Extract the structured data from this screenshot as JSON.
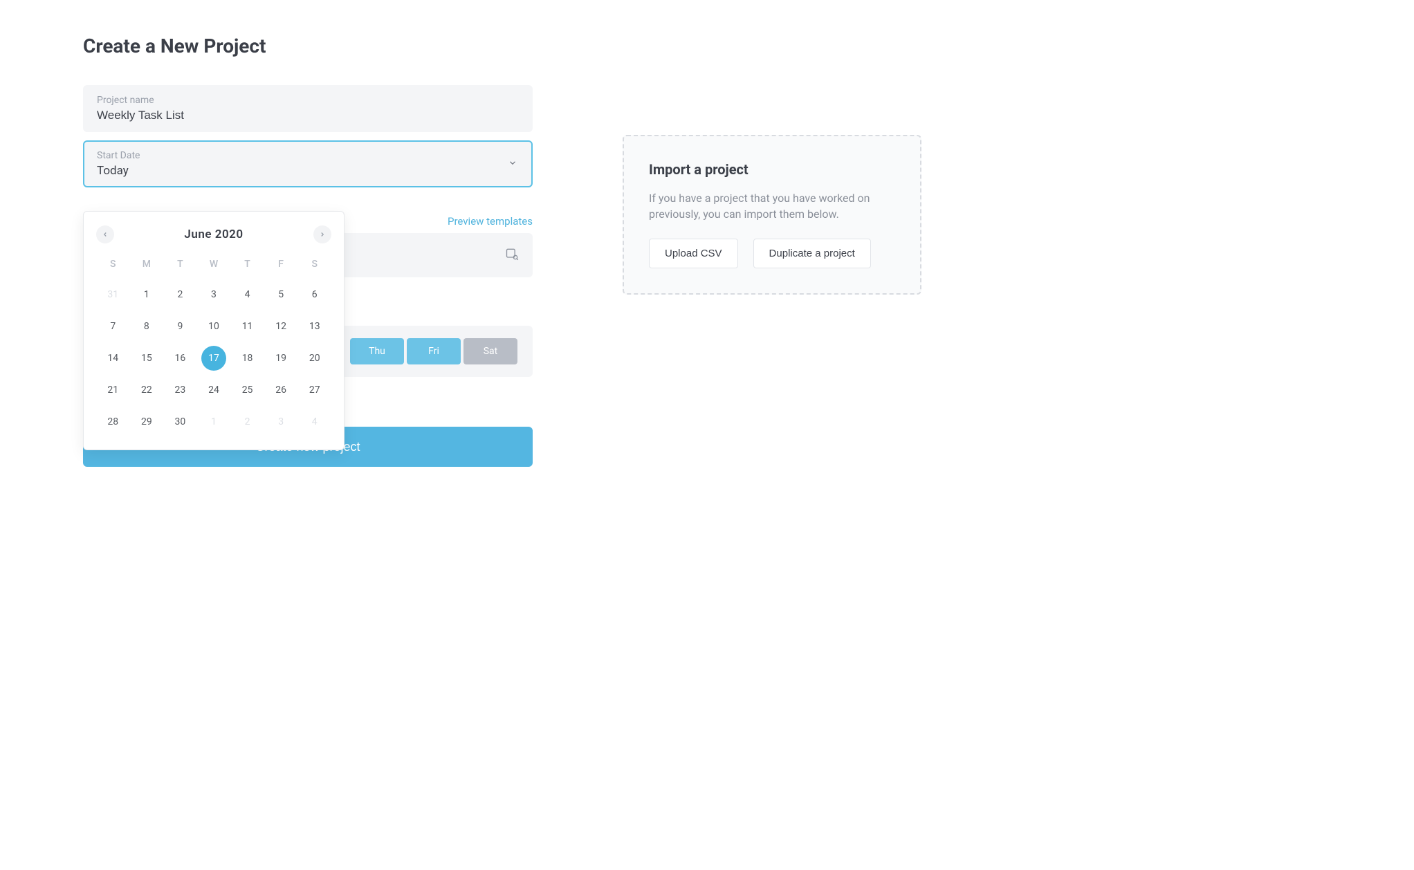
{
  "page": {
    "title": "Create a New Project"
  },
  "form": {
    "project_name": {
      "label": "Project name",
      "value": "Weekly Task List"
    },
    "start_date": {
      "label": "Start Date",
      "value": "Today"
    },
    "preview_templates": "Preview templates",
    "submit": "Create new project"
  },
  "calendar": {
    "month_label": "June 2020",
    "dow": [
      "S",
      "M",
      "T",
      "W",
      "T",
      "F",
      "S"
    ],
    "weeks": [
      [
        {
          "d": "31",
          "other": true
        },
        {
          "d": "1"
        },
        {
          "d": "2"
        },
        {
          "d": "3"
        },
        {
          "d": "4"
        },
        {
          "d": "5"
        },
        {
          "d": "6"
        }
      ],
      [
        {
          "d": "7"
        },
        {
          "d": "8"
        },
        {
          "d": "9"
        },
        {
          "d": "10"
        },
        {
          "d": "11"
        },
        {
          "d": "12"
        },
        {
          "d": "13"
        }
      ],
      [
        {
          "d": "14"
        },
        {
          "d": "15"
        },
        {
          "d": "16"
        },
        {
          "d": "17",
          "selected": true
        },
        {
          "d": "18"
        },
        {
          "d": "19"
        },
        {
          "d": "20"
        }
      ],
      [
        {
          "d": "21"
        },
        {
          "d": "22"
        },
        {
          "d": "23"
        },
        {
          "d": "24"
        },
        {
          "d": "25"
        },
        {
          "d": "26"
        },
        {
          "d": "27"
        }
      ],
      [
        {
          "d": "28"
        },
        {
          "d": "29"
        },
        {
          "d": "30"
        },
        {
          "d": "1",
          "other": true
        },
        {
          "d": "2",
          "other": true
        },
        {
          "d": "3",
          "other": true
        },
        {
          "d": "4",
          "other": true
        }
      ]
    ]
  },
  "days": [
    {
      "label": "Thu",
      "active": true
    },
    {
      "label": "Fri",
      "active": true
    },
    {
      "label": "Sat",
      "active": false
    }
  ],
  "import": {
    "title": "Import a project",
    "desc": "If you have a project that you have worked on previously, you can import them below.",
    "upload": "Upload CSV",
    "duplicate": "Duplicate a project"
  }
}
